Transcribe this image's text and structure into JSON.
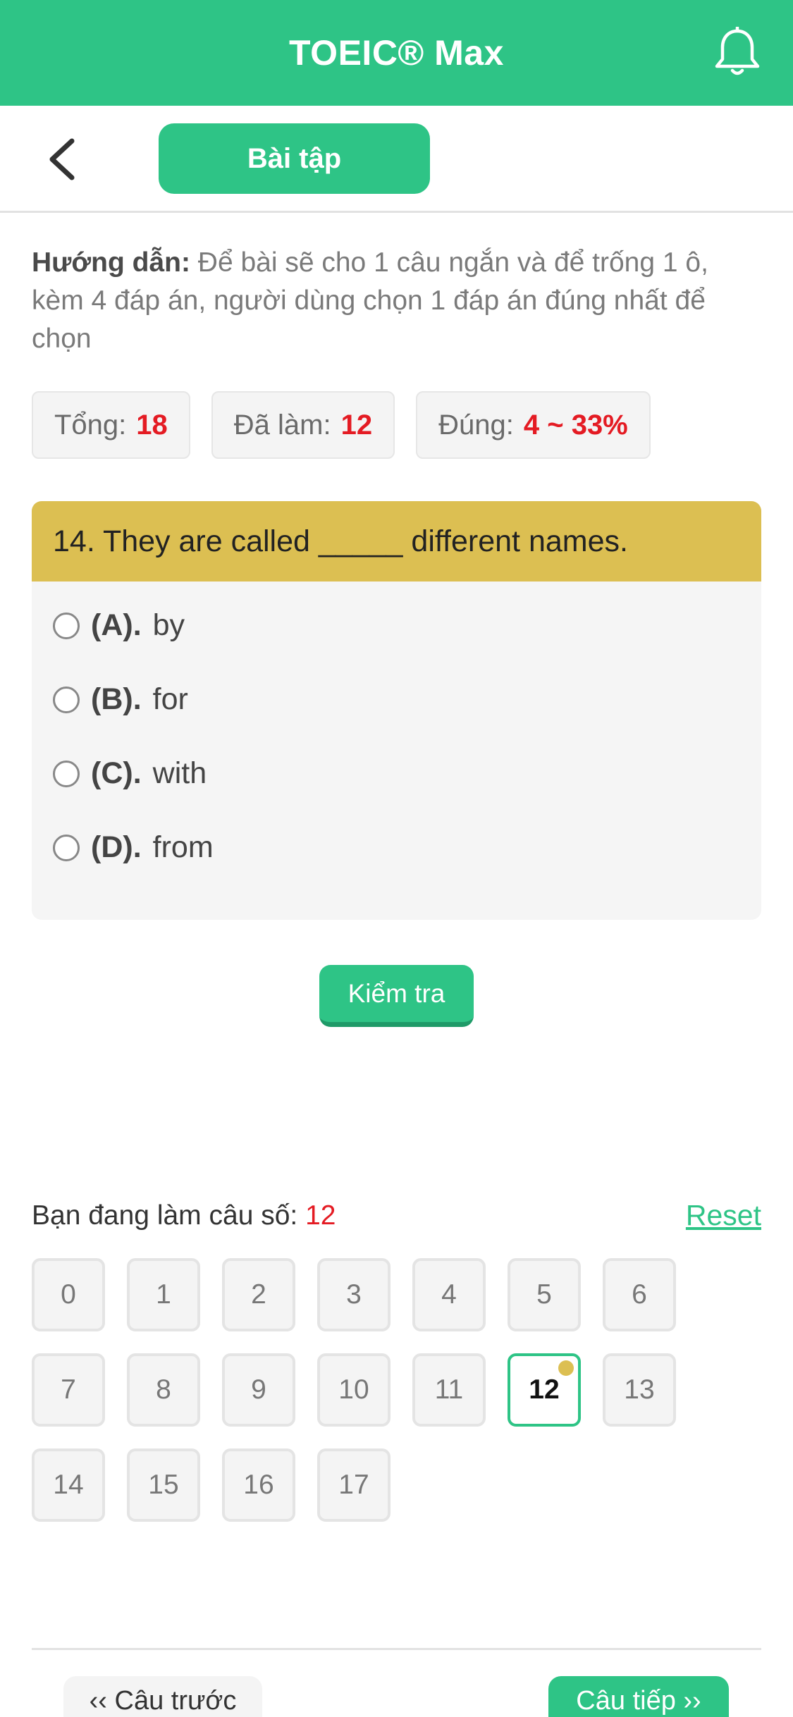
{
  "header": {
    "title": "TOEIC® Max",
    "bell_icon": "bell-icon"
  },
  "toolbar": {
    "back_icon": "chevron-left-icon",
    "tab_label": "Bài tập"
  },
  "instructions": {
    "label": "Hướng dẫn:",
    "text": " Để bài sẽ cho 1 câu ngắn và để trống 1 ô, kèm 4 đáp án, người dùng chọn 1 đáp án đúng nhất để chọn"
  },
  "stats": {
    "total_label": "Tổng:",
    "total_value": "18",
    "done_label": "Đã làm:",
    "done_value": "12",
    "correct_label": "Đúng:",
    "correct_value": "4 ~ 33%"
  },
  "question": {
    "text": "14. They are called _____ different names.",
    "options": [
      {
        "letter": "(A).",
        "text": "by"
      },
      {
        "letter": "(B).",
        "text": "for"
      },
      {
        "letter": "(C).",
        "text": "with"
      },
      {
        "letter": "(D).",
        "text": "from"
      }
    ]
  },
  "check_button": "Kiểm tra",
  "progress": {
    "current_label": "Bạn đang làm câu số:",
    "current_value": "12",
    "reset_label": "Reset",
    "numbers": [
      "0",
      "1",
      "2",
      "3",
      "4",
      "5",
      "6",
      "7",
      "8",
      "9",
      "10",
      "11",
      "12",
      "13",
      "14",
      "15",
      "16",
      "17"
    ],
    "active": "12"
  },
  "nav": {
    "prev_label": "‹‹ Câu trước",
    "next_label": "Câu tiếp ››"
  },
  "colors": {
    "primary": "#2ec486",
    "highlight": "#dcbf52",
    "accent_red": "#e41b23"
  }
}
